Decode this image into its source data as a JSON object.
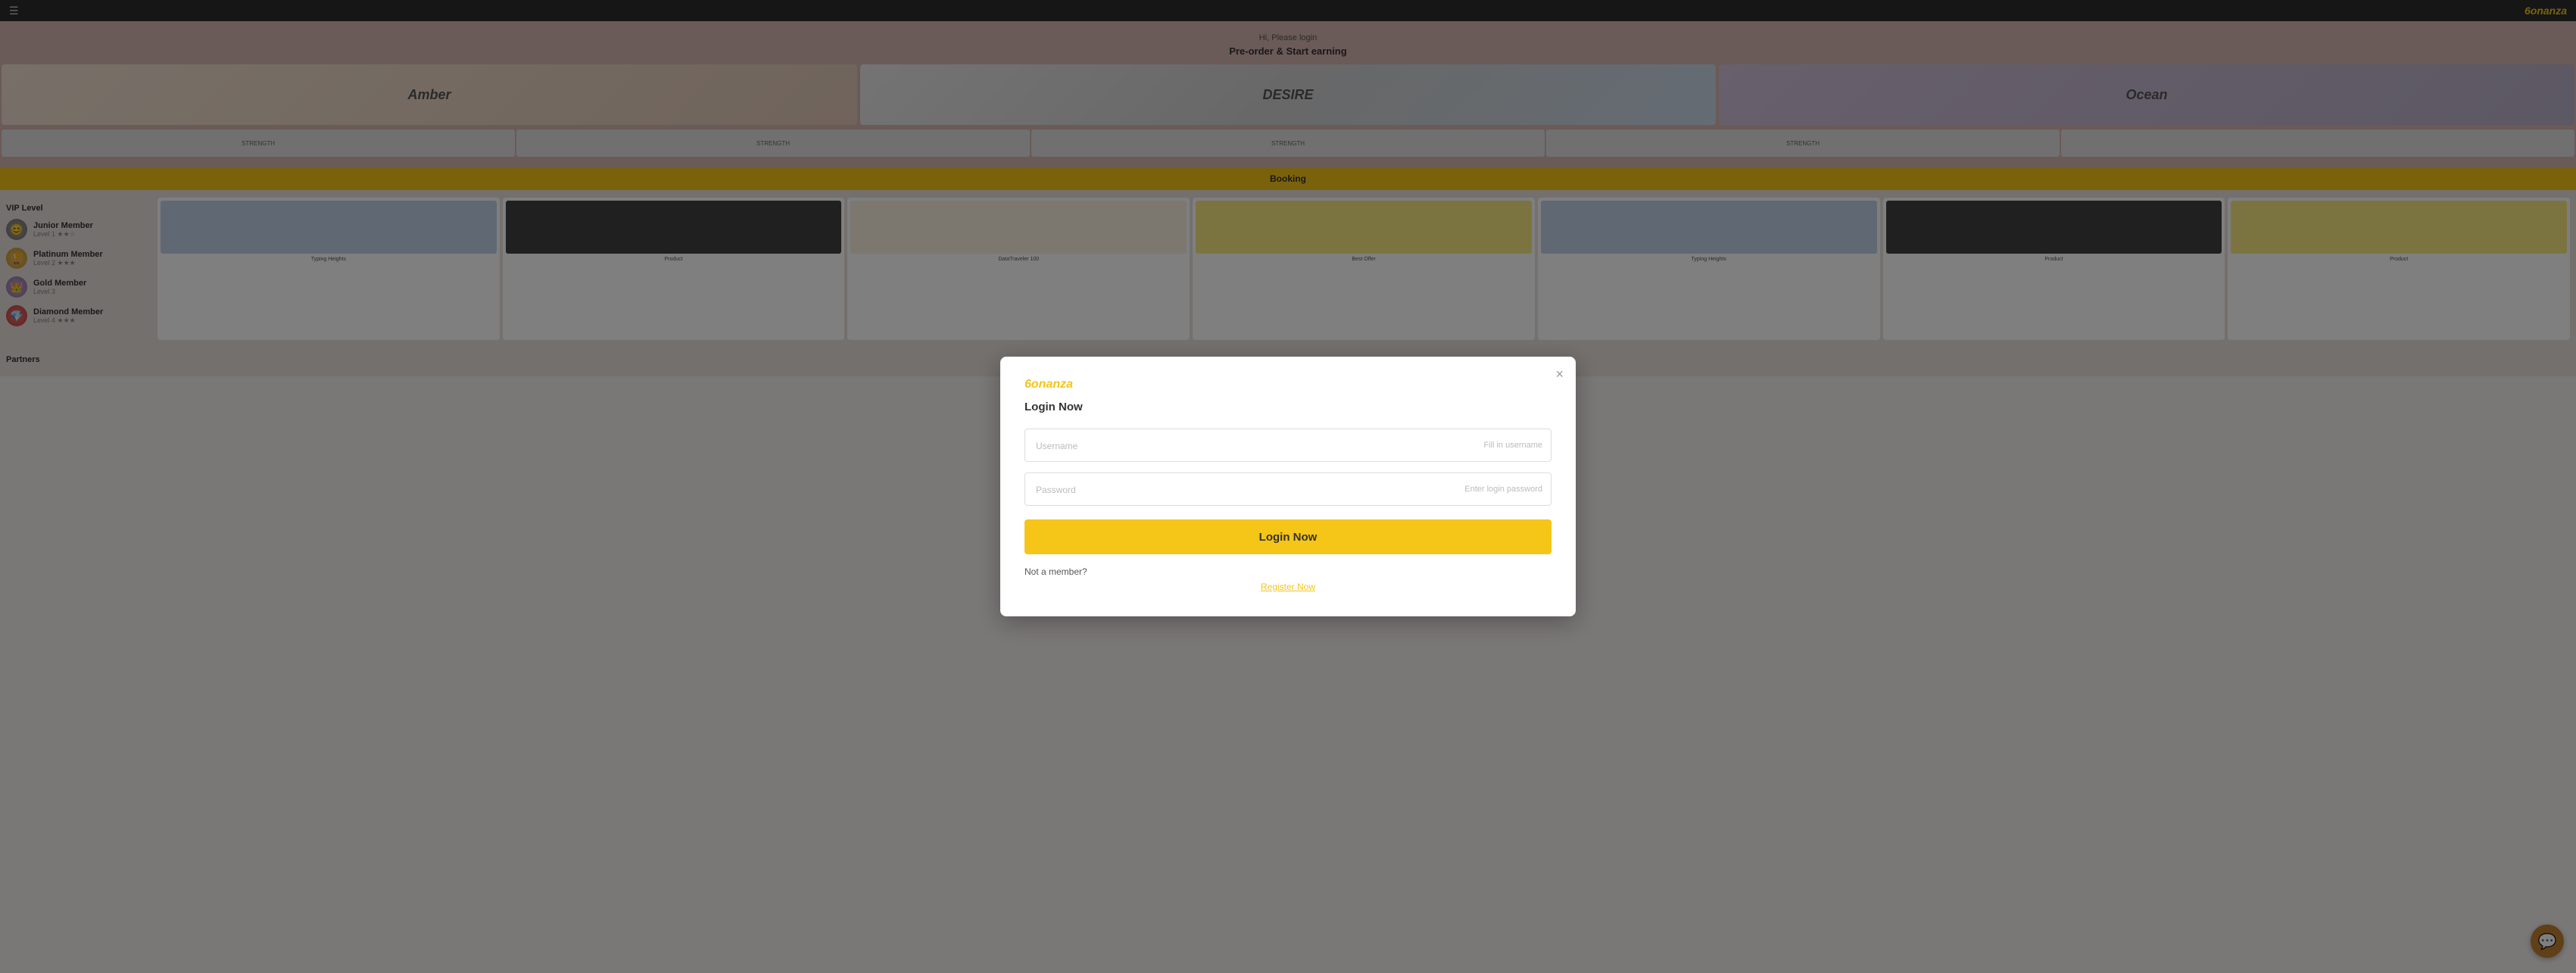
{
  "topbar": {
    "brand": "6onanza",
    "hamburger_icon": "☰"
  },
  "hero": {
    "text": "Hi, Please login",
    "title": "Pre-order & Start earning"
  },
  "banners": [
    {
      "label": "Amber",
      "type": "left"
    },
    {
      "label": "DESIRE",
      "type": "mid"
    },
    {
      "label": "Ocean",
      "type": "right"
    }
  ],
  "strip_banners": [
    {
      "label": "STRENGTH"
    },
    {
      "label": "STRENGTH"
    },
    {
      "label": "STRENGTH"
    },
    {
      "label": "STRENGTH"
    },
    {
      "label": ""
    }
  ],
  "booking_bar": {
    "label": "Booking"
  },
  "sidebar": {
    "title": "VIP Level",
    "items": [
      {
        "name": "Junior Member",
        "sub": "Level 1 ★★☆",
        "avatar_class": "junior",
        "emoji": "😊"
      },
      {
        "name": "Platinum Member",
        "sub": "Level 2 ★★★",
        "avatar_class": "platinum",
        "emoji": "🏆"
      },
      {
        "name": "Gold Member",
        "sub": "Level 3",
        "avatar_class": "gold",
        "emoji": "👑"
      },
      {
        "name": "Diamond Member",
        "sub": "Level 4 ★★★",
        "avatar_class": "diamond",
        "emoji": "💎"
      }
    ]
  },
  "products": [
    {
      "label": "Typing Heights",
      "bg": "blue-bg"
    },
    {
      "label": "Product",
      "bg": "dark-bg"
    },
    {
      "label": "DataTraveler 100",
      "bg": "light-bg"
    },
    {
      "label": "Best Offer",
      "bg": "yellow-bg"
    },
    {
      "label": "Typing Heights",
      "bg": "blue-bg"
    },
    {
      "label": "Product",
      "bg": "dark-bg"
    },
    {
      "label": "Product",
      "bg": "yellow-bg"
    }
  ],
  "partners": {
    "title": "Partners"
  },
  "modal": {
    "brand": "6onanza",
    "title": "Login Now",
    "username_placeholder": "Username",
    "username_hint": "Fill in username",
    "password_placeholder": "Password",
    "password_hint": "Enter login password",
    "login_button": "Login Now",
    "not_member_text": "Not a member?",
    "register_link": "Register Now",
    "close_icon": "×"
  },
  "chat": {
    "icon": "💬"
  }
}
